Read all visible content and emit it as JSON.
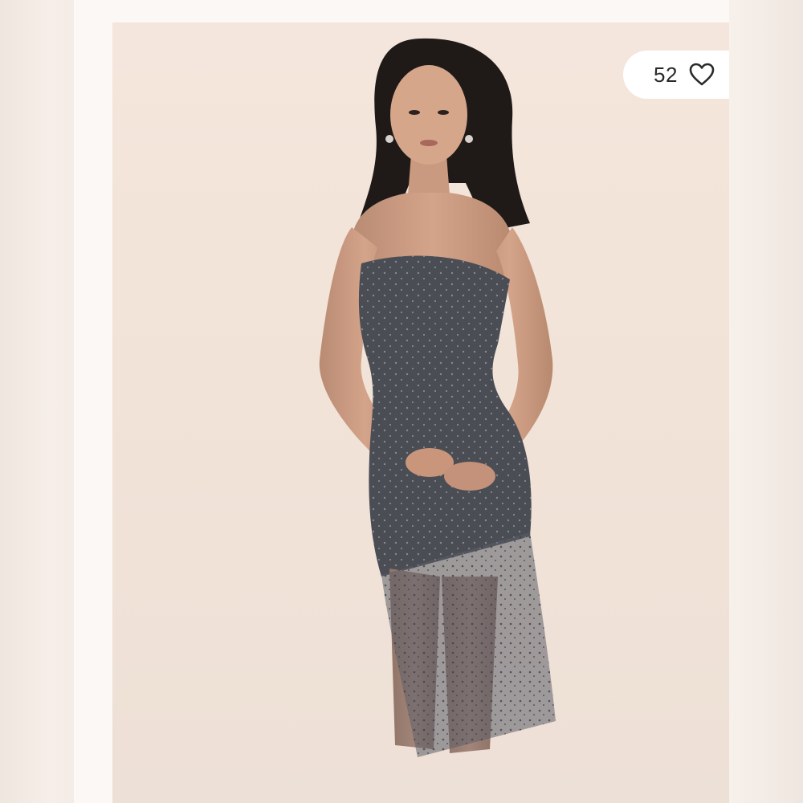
{
  "listing": {
    "like_count": "52",
    "like_icon": "heart-outline-icon"
  },
  "photo": {
    "subject": "model-in-strapless-sheer-mesh-midi-dress",
    "background_color": "#f2e3d8",
    "dress_color": "#4b4d55"
  },
  "colors": {
    "like_pill_bg": "#ffffff",
    "text": "#2a2a2a"
  }
}
